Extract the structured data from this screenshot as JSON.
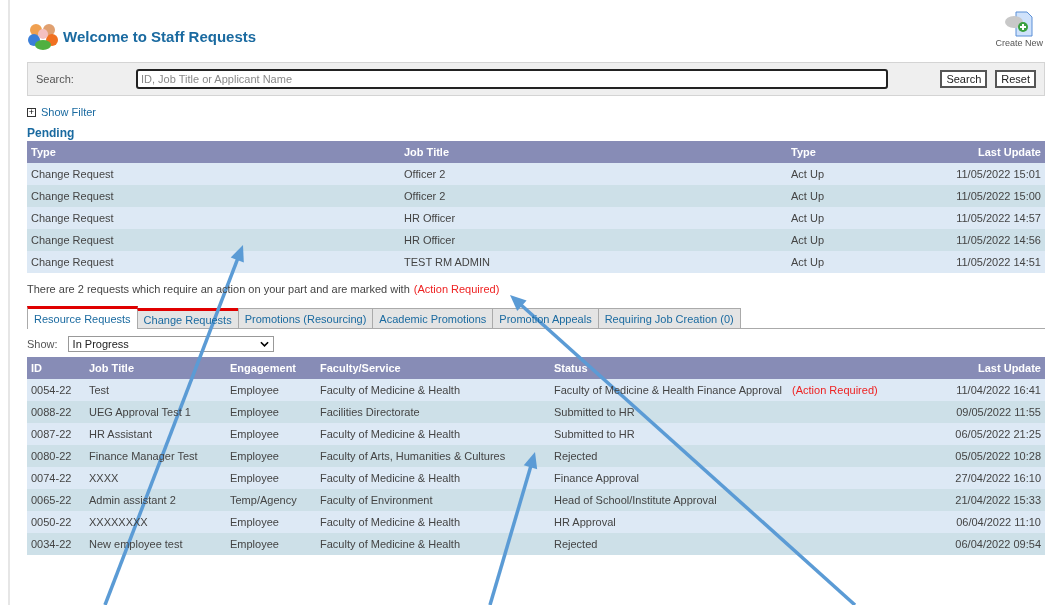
{
  "header": {
    "title": "Welcome to Staff Requests",
    "create_new": "Create New"
  },
  "search": {
    "label": "Search:",
    "placeholder": "ID, Job Title or Applicant Name",
    "buttons": [
      "Search",
      "Reset"
    ]
  },
  "filter_toggle": {
    "icon": "+",
    "label": "Show Filter",
    "expanded": false
  },
  "pending": {
    "title": "Pending",
    "columns": [
      "Type",
      "Job Title",
      "Type",
      "Last Update"
    ],
    "rows": [
      [
        "Change Request",
        "Officer 2",
        "Act Up",
        "11/05/2022 15:01"
      ],
      [
        "Change Request",
        "Officer 2",
        "Act Up",
        "11/05/2022 15:00"
      ],
      [
        "Change Request",
        "HR Officer",
        "Act Up",
        "11/05/2022 14:57"
      ],
      [
        "Change Request",
        "HR Officer",
        "Act Up",
        "11/05/2022 14:56"
      ],
      [
        "Change Request",
        "TEST RM ADMIN",
        "Act Up",
        "11/05/2022 14:51"
      ]
    ]
  },
  "notice": {
    "text": "There are 2 requests which require an action on your part and are marked with",
    "flag": "(Action Required)"
  },
  "tabs": [
    {
      "label": "Resource Requests",
      "selected": true,
      "flagged": true
    },
    {
      "label": "Change Requests",
      "selected": false,
      "flagged": true
    },
    {
      "label": "Promotions (Resourcing)",
      "selected": false,
      "flagged": false
    },
    {
      "label": "Academic Promotions",
      "selected": false,
      "flagged": false
    },
    {
      "label": "Promotion Appeals",
      "selected": false,
      "flagged": false
    },
    {
      "label": "Requiring Job Creation (0)",
      "selected": false,
      "flagged": false
    }
  ],
  "show": {
    "label": "Show:",
    "value": "In Progress"
  },
  "requests": {
    "columns": [
      "ID",
      "Job Title",
      "Engagement",
      "Faculty/Service",
      "Status",
      "Last Update"
    ],
    "rows": [
      {
        "id": "0054-22",
        "job_title": "Test",
        "engagement": "Employee",
        "faculty": "Faculty of Medicine & Health",
        "status": "Faculty of Medicine & Health Finance Approval",
        "action": "(Action Required)",
        "updated": "11/04/2022 16:41"
      },
      {
        "id": "0088-22",
        "job_title": "UEG Approval Test 1",
        "engagement": "Employee",
        "faculty": "Facilities Directorate",
        "status": "Submitted to HR",
        "updated": "09/05/2022 11:55"
      },
      {
        "id": "0087-22",
        "job_title": "HR Assistant",
        "engagement": "Employee",
        "faculty": "Faculty of Medicine & Health",
        "status": "Submitted to HR",
        "updated": "06/05/2022 21:25"
      },
      {
        "id": "0080-22",
        "job_title": "Finance Manager Test",
        "engagement": "Employee",
        "faculty": "Faculty of Arts, Humanities & Cultures",
        "status": "Rejected",
        "updated": "05/05/2022 10:28"
      },
      {
        "id": "0074-22",
        "job_title": "XXXX",
        "engagement": "Employee",
        "faculty": "Faculty of Medicine & Health",
        "status": "Finance Approval",
        "updated": "27/04/2022 16:10"
      },
      {
        "id": "0065-22",
        "job_title": "Admin assistant 2",
        "engagement": "Temp/Agency",
        "faculty": "Faculty of Environment",
        "status": "Head of School/Institute Approval",
        "updated": "21/04/2022 15:33"
      },
      {
        "id": "0050-22",
        "job_title": "XXXXXXXX",
        "engagement": "Employee",
        "faculty": "Faculty of Medicine & Health",
        "status": "HR Approval",
        "updated": "06/04/2022 11:10"
      },
      {
        "id": "0034-22",
        "job_title": "New employee test",
        "engagement": "Employee",
        "faculty": "Faculty of Medicine & Health",
        "status": "Rejected",
        "updated": "06/04/2022 09:54"
      }
    ]
  }
}
